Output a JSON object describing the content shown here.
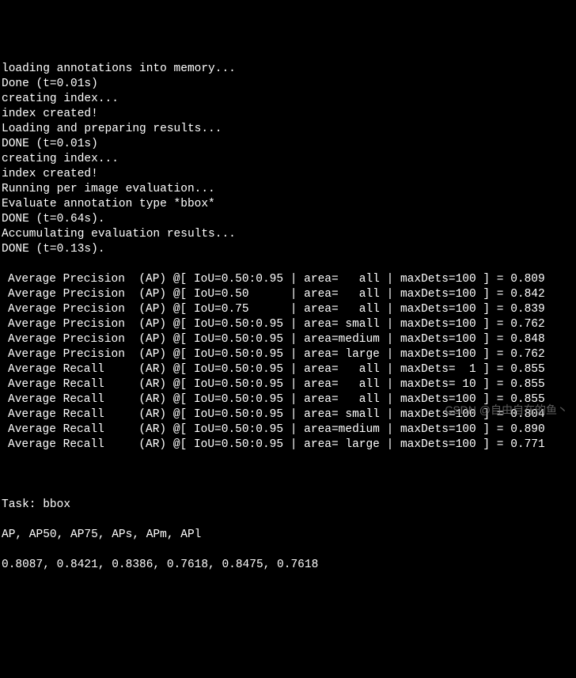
{
  "log_lines": [
    "loading annotations into memory...",
    "Done (t=0.01s)",
    "creating index...",
    "index created!",
    "Loading and preparing results...",
    "DONE (t=0.01s)",
    "creating index...",
    "index created!",
    "Running per image evaluation...",
    "Evaluate annotation type *bbox*",
    "DONE (t=0.64s).",
    "Accumulating evaluation results...",
    "DONE (t=0.13s)."
  ],
  "metrics": [
    {
      "name": "Average Precision",
      "abbr": "AP",
      "iou": "0.50:0.95",
      "area": "   all",
      "maxDets": "100",
      "value": "0.809"
    },
    {
      "name": "Average Precision",
      "abbr": "AP",
      "iou": "0.50     ",
      "area": "   all",
      "maxDets": "100",
      "value": "0.842"
    },
    {
      "name": "Average Precision",
      "abbr": "AP",
      "iou": "0.75     ",
      "area": "   all",
      "maxDets": "100",
      "value": "0.839"
    },
    {
      "name": "Average Precision",
      "abbr": "AP",
      "iou": "0.50:0.95",
      "area": " small",
      "maxDets": "100",
      "value": "0.762"
    },
    {
      "name": "Average Precision",
      "abbr": "AP",
      "iou": "0.50:0.95",
      "area": "medium",
      "maxDets": "100",
      "value": "0.848"
    },
    {
      "name": "Average Precision",
      "abbr": "AP",
      "iou": "0.50:0.95",
      "area": " large",
      "maxDets": "100",
      "value": "0.762"
    },
    {
      "name": "Average Recall   ",
      "abbr": "AR",
      "iou": "0.50:0.95",
      "area": "   all",
      "maxDets": "  1",
      "value": "0.855"
    },
    {
      "name": "Average Recall   ",
      "abbr": "AR",
      "iou": "0.50:0.95",
      "area": "   all",
      "maxDets": " 10",
      "value": "0.855"
    },
    {
      "name": "Average Recall   ",
      "abbr": "AR",
      "iou": "0.50:0.95",
      "area": "   all",
      "maxDets": "100",
      "value": "0.855"
    },
    {
      "name": "Average Recall   ",
      "abbr": "AR",
      "iou": "0.50:0.95",
      "area": " small",
      "maxDets": "100",
      "value": "0.804"
    },
    {
      "name": "Average Recall   ",
      "abbr": "AR",
      "iou": "0.50:0.95",
      "area": "medium",
      "maxDets": "100",
      "value": "0.890"
    },
    {
      "name": "Average Recall   ",
      "abbr": "AR",
      "iou": "0.50:0.95",
      "area": " large",
      "maxDets": "100",
      "value": "0.771"
    }
  ],
  "task_line": "Task: bbox",
  "summary_header": "AP, AP50, AP75, APs, APm, APl",
  "summary_values": "0.8087, 0.8421, 0.8386, 0.7618, 0.8475, 0.7618",
  "watermark": "CSDN @自由自在的鱼丶"
}
